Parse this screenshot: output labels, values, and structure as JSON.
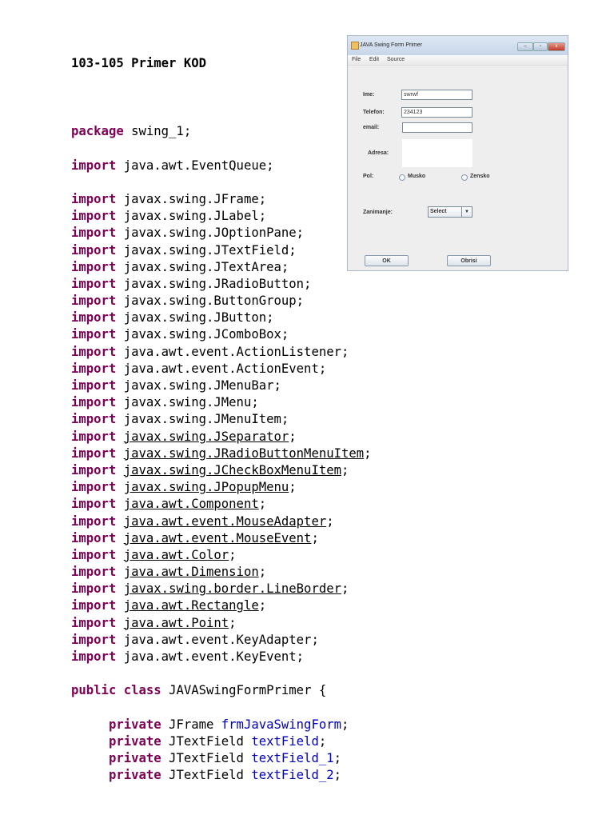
{
  "document": {
    "title": "103-105 Primer KOD",
    "lines": [
      [],
      [
        {
          "t": "package",
          "c": "kw"
        },
        {
          "t": " swing_1;"
        }
      ],
      [],
      [
        {
          "t": "import",
          "c": "kw"
        },
        {
          "t": " java.awt.EventQueue;"
        }
      ],
      [],
      [
        {
          "t": "import",
          "c": "kw"
        },
        {
          "t": " javax.swing.JFrame;"
        }
      ],
      [
        {
          "t": "import",
          "c": "kw"
        },
        {
          "t": " javax.swing.JLabel;"
        }
      ],
      [
        {
          "t": "import",
          "c": "kw"
        },
        {
          "t": " javax.swing.JOptionPane;"
        }
      ],
      [
        {
          "t": "import",
          "c": "kw"
        },
        {
          "t": " javax.swing.JTextField;"
        }
      ],
      [
        {
          "t": "import",
          "c": "kw"
        },
        {
          "t": " javax.swing.JTextArea;"
        }
      ],
      [
        {
          "t": "import",
          "c": "kw"
        },
        {
          "t": " javax.swing.JRadioButton;"
        }
      ],
      [
        {
          "t": "import",
          "c": "kw"
        },
        {
          "t": " javax.swing.ButtonGroup;"
        }
      ],
      [
        {
          "t": "import",
          "c": "kw"
        },
        {
          "t": " javax.swing.JButton;"
        }
      ],
      [
        {
          "t": "import",
          "c": "kw"
        },
        {
          "t": " javax.swing.JComboBox;"
        }
      ],
      [
        {
          "t": "import",
          "c": "kw"
        },
        {
          "t": " java.awt.event.ActionListener;"
        }
      ],
      [
        {
          "t": "import",
          "c": "kw"
        },
        {
          "t": " java.awt.event.ActionEvent;"
        }
      ],
      [
        {
          "t": "import",
          "c": "kw"
        },
        {
          "t": " javax.swing.JMenuBar;"
        }
      ],
      [
        {
          "t": "import",
          "c": "kw"
        },
        {
          "t": " javax.swing.JMenu;"
        }
      ],
      [
        {
          "t": "import",
          "c": "kw"
        },
        {
          "t": " javax.swing.JMenuItem;"
        }
      ],
      [
        {
          "t": "import",
          "c": "kw"
        },
        {
          "t": " "
        },
        {
          "t": "javax.swing.JSeparator",
          "c": "ul"
        },
        {
          "t": ";"
        }
      ],
      [
        {
          "t": "import",
          "c": "kw"
        },
        {
          "t": " "
        },
        {
          "t": "javax.swing.JRadioButtonMenuItem",
          "c": "ul"
        },
        {
          "t": ";"
        }
      ],
      [
        {
          "t": "import",
          "c": "kw"
        },
        {
          "t": " "
        },
        {
          "t": "javax.swing.JCheckBoxMenuItem",
          "c": "ul"
        },
        {
          "t": ";"
        }
      ],
      [
        {
          "t": "import",
          "c": "kw"
        },
        {
          "t": " "
        },
        {
          "t": "javax.swing.JPopupMenu",
          "c": "ul"
        },
        {
          "t": ";"
        }
      ],
      [
        {
          "t": "import",
          "c": "kw"
        },
        {
          "t": " "
        },
        {
          "t": "java.awt.Component",
          "c": "ul"
        },
        {
          "t": ";"
        }
      ],
      [
        {
          "t": "import",
          "c": "kw"
        },
        {
          "t": " "
        },
        {
          "t": "java.awt.event.MouseAdapter",
          "c": "ul"
        },
        {
          "t": ";"
        }
      ],
      [
        {
          "t": "import",
          "c": "kw"
        },
        {
          "t": " "
        },
        {
          "t": "java.awt.event.MouseEvent",
          "c": "ul"
        },
        {
          "t": ";"
        }
      ],
      [
        {
          "t": "import",
          "c": "kw"
        },
        {
          "t": " "
        },
        {
          "t": "java.awt.Color",
          "c": "ul"
        },
        {
          "t": ";"
        }
      ],
      [
        {
          "t": "import",
          "c": "kw"
        },
        {
          "t": " "
        },
        {
          "t": "java.awt.Dimension",
          "c": "ul"
        },
        {
          "t": ";"
        }
      ],
      [
        {
          "t": "import",
          "c": "kw"
        },
        {
          "t": " "
        },
        {
          "t": "javax.swing.border.LineBorder",
          "c": "ul"
        },
        {
          "t": ";"
        }
      ],
      [
        {
          "t": "import",
          "c": "kw"
        },
        {
          "t": " "
        },
        {
          "t": "java.awt.Rectangle",
          "c": "ul"
        },
        {
          "t": ";"
        }
      ],
      [
        {
          "t": "import",
          "c": "kw"
        },
        {
          "t": " "
        },
        {
          "t": "java.awt.Point",
          "c": "ul"
        },
        {
          "t": ";"
        }
      ],
      [
        {
          "t": "import",
          "c": "kw"
        },
        {
          "t": " java.awt.event.KeyAdapter;"
        }
      ],
      [
        {
          "t": "import",
          "c": "kw"
        },
        {
          "t": " java.awt.event.KeyEvent;"
        }
      ],
      [],
      [
        {
          "t": "public",
          "c": "kw"
        },
        {
          "t": " "
        },
        {
          "t": "class",
          "c": "kw"
        },
        {
          "t": " JAVASwingFormPrimer {"
        }
      ],
      [],
      [
        {
          "t": "     "
        },
        {
          "t": "private",
          "c": "kw"
        },
        {
          "t": " JFrame "
        },
        {
          "t": "frmJavaSwingForm",
          "c": "fld"
        },
        {
          "t": ";"
        }
      ],
      [
        {
          "t": "     "
        },
        {
          "t": "private",
          "c": "kw"
        },
        {
          "t": " JTextField "
        },
        {
          "t": "textField",
          "c": "fld"
        },
        {
          "t": ";"
        }
      ],
      [
        {
          "t": "     "
        },
        {
          "t": "private",
          "c": "kw"
        },
        {
          "t": " JTextField "
        },
        {
          "t": "textField_1",
          "c": "fld"
        },
        {
          "t": ";"
        }
      ],
      [
        {
          "t": "     "
        },
        {
          "t": "private",
          "c": "kw"
        },
        {
          "t": " JTextField "
        },
        {
          "t": "textField_2",
          "c": "fld"
        },
        {
          "t": ";"
        }
      ]
    ]
  },
  "window": {
    "title": "JAVA Swing Form Primer",
    "menu": [
      "File",
      "Edit",
      "Source"
    ],
    "labels": {
      "ime": "Ime:",
      "telefon": "Telefon:",
      "email": "email:",
      "adresa": "Adresa:",
      "pol": "Pol:",
      "zanimanje": "Zanimanje:"
    },
    "values": {
      "ime": "swrwf",
      "telefon": "234123",
      "email": ""
    },
    "radios": [
      "Musko",
      "Zensko"
    ],
    "combo": "Select",
    "buttons": {
      "ok": "OK",
      "obrisi": "Obrisi"
    },
    "controls": {
      "minimize": "–",
      "maximize": "▫",
      "close": "x"
    }
  }
}
